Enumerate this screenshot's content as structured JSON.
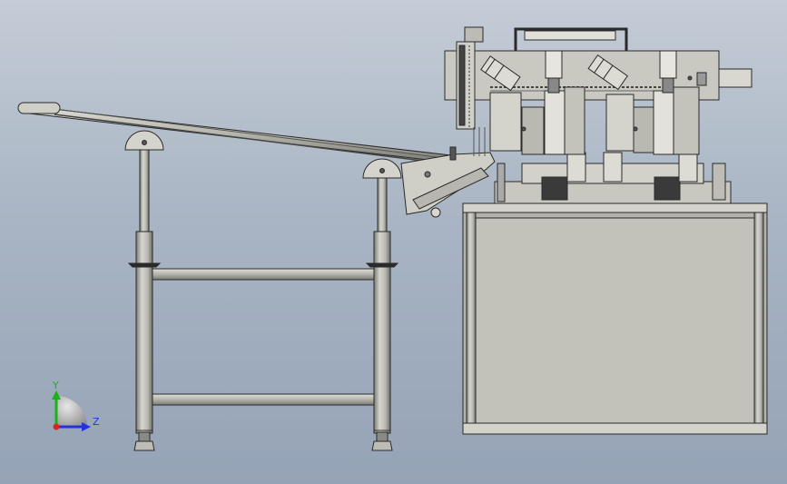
{
  "triad": {
    "y_label": "Y",
    "z_label": "Z",
    "colors": {
      "y": "#19b319",
      "z": "#2233dd",
      "x": "#dd2222",
      "sphere": "#b8b8b8"
    }
  },
  "colors": {
    "background_top": "#c4ccd6",
    "background_bottom": "#95a3b6",
    "frame": "#c9c9c0",
    "frame_dark": "#8e8e86",
    "cabinet_panel": "#c2c2bb",
    "outline": "#2a2a2a",
    "dark_block": "#3a3a3a"
  }
}
